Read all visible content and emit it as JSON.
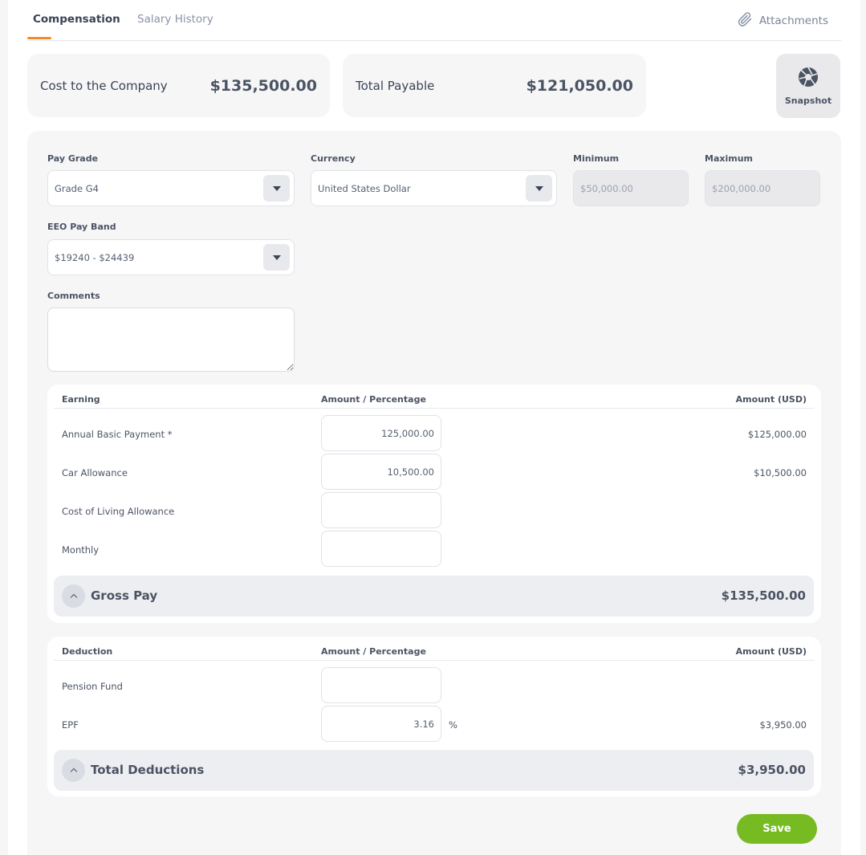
{
  "tabs": [
    {
      "label": "Compensation",
      "active": true
    },
    {
      "label": "Salary History",
      "active": false
    }
  ],
  "attachments_label": "Attachments",
  "summary": {
    "cost_to_company": {
      "label": "Cost to the Company",
      "value": "$135,500.00"
    },
    "total_payable": {
      "label": "Total Payable",
      "value": "$121,050.00"
    },
    "snapshot_label": "Snapshot"
  },
  "form": {
    "pay_grade": {
      "label": "Pay Grade",
      "value": "Grade G4"
    },
    "currency": {
      "label": "Currency",
      "value": "United States Dollar"
    },
    "minimum": {
      "label": "Minimum",
      "value": "$50,000.00"
    },
    "maximum": {
      "label": "Maximum",
      "value": "$200,000.00"
    },
    "eeo_pay_band": {
      "label": "EEO Pay Band",
      "value": "$19240 - $24439"
    },
    "comments": {
      "label": "Comments",
      "value": ""
    }
  },
  "earnings": {
    "headers": {
      "name": "Earning",
      "amount_pct": "Amount / Percentage",
      "amount": "Amount (USD)"
    },
    "rows": [
      {
        "label": "Annual Basic Payment *",
        "input": "125,000.00",
        "amount": "$125,000.00"
      },
      {
        "label": "Car Allowance",
        "input": "10,500.00",
        "amount": "$10,500.00"
      },
      {
        "label": "Cost of Living Allowance",
        "input": "",
        "amount": ""
      },
      {
        "label": "Monthly",
        "input": "",
        "amount": ""
      }
    ],
    "total_label": "Gross Pay",
    "total_value": "$135,500.00"
  },
  "deductions": {
    "headers": {
      "name": "Deduction",
      "amount_pct": "Amount / Percentage",
      "amount": "Amount (USD)"
    },
    "rows": [
      {
        "label": "Pension Fund",
        "input": "",
        "suffix": "",
        "amount": ""
      },
      {
        "label": "EPF",
        "input": "3.16",
        "suffix": "%",
        "amount": "$3,950.00"
      }
    ],
    "total_label": "Total Deductions",
    "total_value": "$3,950.00"
  },
  "save_label": "Save",
  "colors": {
    "accent": "#f28c28",
    "save": "#76bb22"
  }
}
